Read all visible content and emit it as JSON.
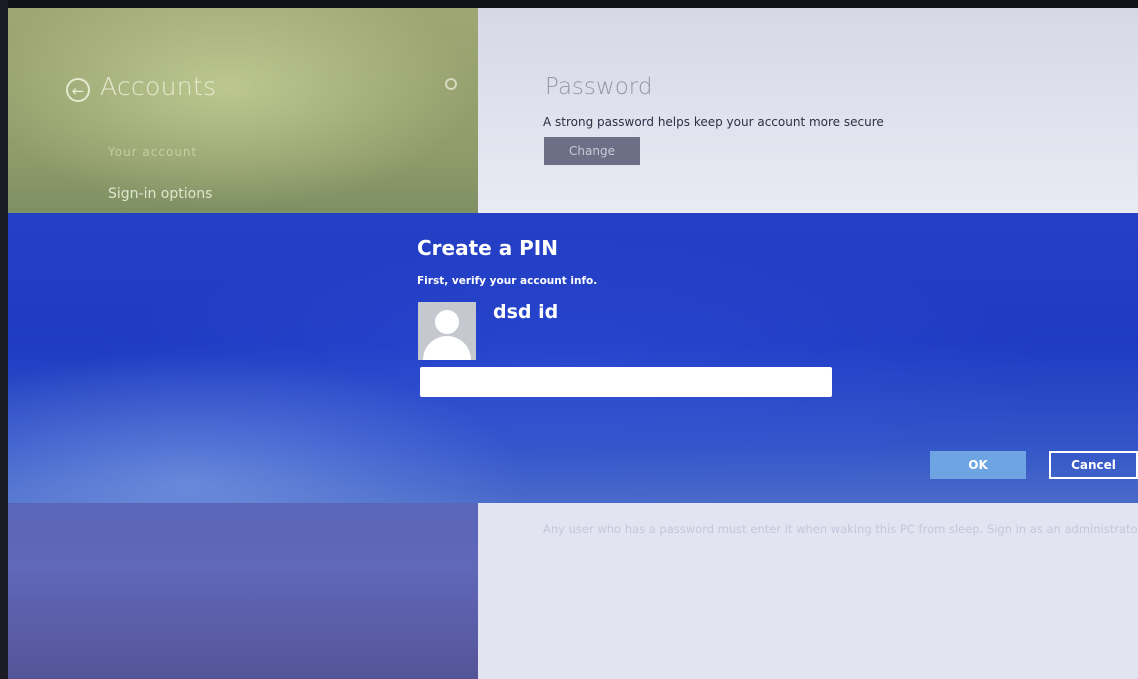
{
  "accounts_pane": {
    "back_icon": "back-arrow-icon",
    "title": "Accounts",
    "search_icon": "search-icon",
    "nav_items": [
      {
        "label": "Your account"
      },
      {
        "label": "Sign-in options"
      }
    ]
  },
  "password_section": {
    "heading": "Password",
    "description": "A strong password helps keep your account more secure",
    "change_button": "Change",
    "below_text": "Any user who has a password must enter it when waking this PC from sleep. Sign in as an administrator to c"
  },
  "pin_dialog": {
    "title": "Create a PIN",
    "subtitle": "First, verify your account info.",
    "avatar_icon": "user-avatar-icon",
    "user_name": "dsd id",
    "password_value": "",
    "ok_label": "OK",
    "cancel_label": "Cancel"
  },
  "colors": {
    "dialog_blue": "#1e3bc2",
    "ok_button": "#6fa4e3",
    "right_pane": "#e2e4f1"
  }
}
